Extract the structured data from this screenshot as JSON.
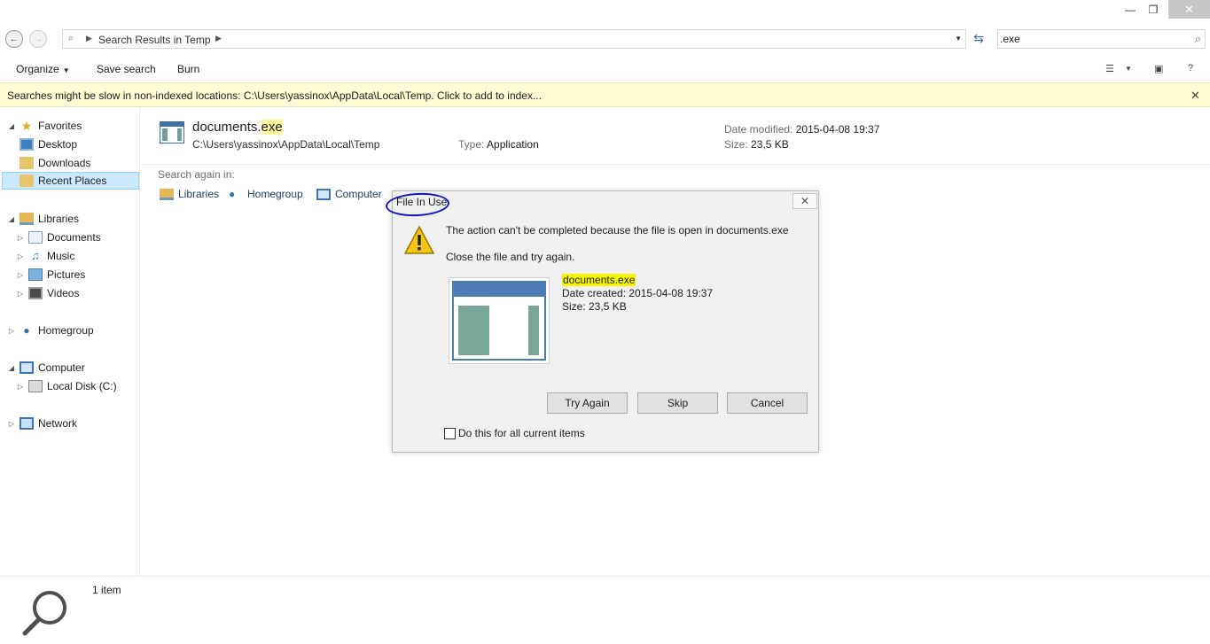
{
  "window": {
    "minimize": "—",
    "maximize": "❐",
    "close": "✕"
  },
  "address": {
    "crumb": "Search Results in Temp",
    "search_value": ".exe"
  },
  "toolbar": {
    "organize": "Organize",
    "save_search": "Save search",
    "burn": "Burn"
  },
  "infobar": {
    "text": "Searches might be slow in non-indexed locations: C:\\Users\\yassinox\\AppData\\Local\\Temp. Click to add to index...",
    "close": "✕"
  },
  "navpane": {
    "favorites": "Favorites",
    "desktop": "Desktop",
    "downloads": "Downloads",
    "recent_places": "Recent Places",
    "libraries": "Libraries",
    "documents": "Documents",
    "music": "Music",
    "pictures": "Pictures",
    "videos": "Videos",
    "homegroup": "Homegroup",
    "computer": "Computer",
    "local_disk": "Local Disk (C:)",
    "network": "Network"
  },
  "result": {
    "name_base": "documents.",
    "name_ext": "exe",
    "path": "C:\\Users\\yassinox\\AppData\\Local\\Temp",
    "type_label": "Type:",
    "type_value": "Application",
    "modified_label": "Date modified:",
    "modified_value": "2015-04-08 19:37",
    "size_label": "Size:",
    "size_value": "23,5 KB"
  },
  "search_again": {
    "label": "Search again in:",
    "libraries": "Libraries",
    "homegroup": "Homegroup",
    "computer": "Computer"
  },
  "status": {
    "count": "1 item"
  },
  "dialog": {
    "title": "File In Use",
    "close": "✕",
    "message": "The action can't be completed because the file is open in documents.exe",
    "instruction": "Close the file and try again.",
    "file_name": "documents.exe",
    "created": "Date created: 2015-04-08 19:37",
    "size": "Size: 23,5 KB",
    "try_again": "Try Again",
    "skip": "Skip",
    "cancel": "Cancel",
    "checkbox_label": "Do this for all current items",
    "annotation_color": "#1515c8",
    "highlight_color": "#f5f500"
  }
}
